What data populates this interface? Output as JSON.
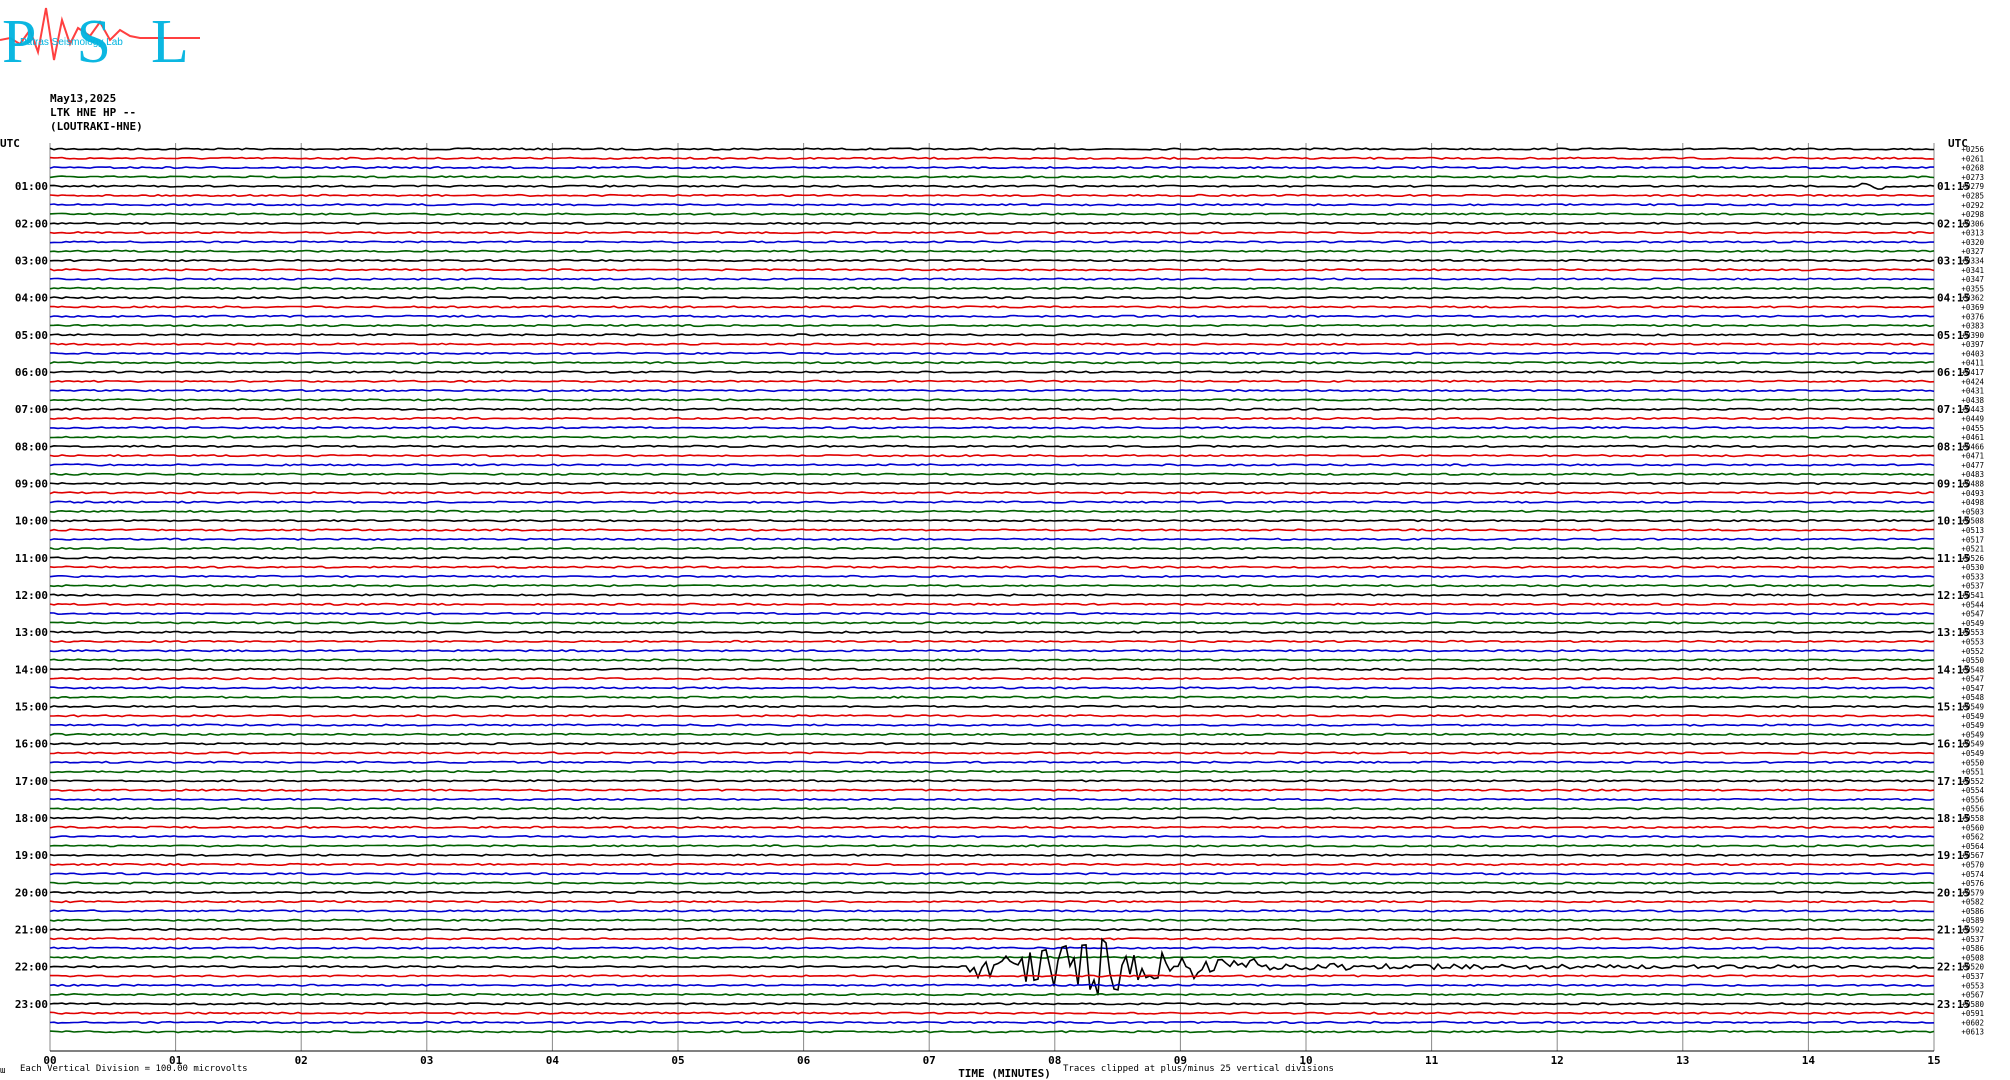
{
  "header": {
    "logo_letters": "PSL",
    "logo_subtext": "Patras Seismology Lab",
    "date": "May13,2025",
    "station_line": "LTK HNE HP --",
    "station_name": "(LOUTRAKI-HNE)"
  },
  "footer": {
    "corner_mark": "ա",
    "vertical_division": "Each Vertical Division =  100.00 microvolts",
    "clip_note": "Traces clipped at plus/minus 25 vertical divisions"
  },
  "colors": {
    "trace_cycle": [
      "#000000",
      "#e00000",
      "#0000d0",
      "#006000"
    ],
    "grid": "#888888",
    "logo_cyan": "#00b4e0",
    "logo_red": "#ff4040"
  },
  "chart_data": {
    "type": "line",
    "title": "",
    "xlabel": "TIME (MINUTES)",
    "ylabel": "UTC",
    "right_axis_label": "UTC",
    "xlim": [
      0,
      15
    ],
    "x_tick_labels": [
      "00",
      "01",
      "02",
      "03",
      "04",
      "05",
      "06",
      "07",
      "08",
      "09",
      "10",
      "11",
      "12",
      "13",
      "14",
      "15"
    ],
    "left_hour_labels": [
      "01:00",
      "02:00",
      "03:00",
      "04:00",
      "05:00",
      "06:00",
      "07:00",
      "08:00",
      "09:00",
      "10:00",
      "11:00",
      "12:00",
      "13:00",
      "14:00",
      "15:00",
      "16:00",
      "17:00",
      "18:00",
      "19:00",
      "20:00",
      "21:00",
      "22:00",
      "23:00"
    ],
    "right_hour_labels": [
      "01:15",
      "02:15",
      "03:15",
      "04:15",
      "05:15",
      "06:15",
      "07:15",
      "08:15",
      "09:15",
      "10:15",
      "11:15",
      "12:15",
      "13:15",
      "14:15",
      "15:15",
      "16:15",
      "17:15",
      "18:15",
      "19:15",
      "20:15",
      "21:15",
      "22:15",
      "23:15"
    ],
    "trace_count": 96,
    "trace_offsets": [
      "+0256",
      "+0261",
      "+0268",
      "+0273",
      "+0279",
      "+0285",
      "+0292",
      "+0298",
      "+0306",
      "+0313",
      "+0320",
      "+0327",
      "+0334",
      "+0341",
      "+0347",
      "+0355",
      "+0362",
      "+0369",
      "+0376",
      "+0383",
      "+0390",
      "+0397",
      "+0403",
      "+0411",
      "+0417",
      "+0424",
      "+0431",
      "+0438",
      "+0443",
      "+0449",
      "+0455",
      "+0461",
      "+0466",
      "+0471",
      "+0477",
      "+0483",
      "+0488",
      "+0493",
      "+0498",
      "+0503",
      "+0508",
      "+0513",
      "+0517",
      "+0521",
      "+0526",
      "+0530",
      "+0533",
      "+0537",
      "+0541",
      "+0544",
      "+0547",
      "+0549",
      "+0553",
      "+0553",
      "+0552",
      "+0550",
      "+0548",
      "+0547",
      "+0547",
      "+0548",
      "+0549",
      "+0549",
      "+0549",
      "+0549",
      "+0549",
      "+0549",
      "+0550",
      "+0551",
      "+0552",
      "+0554",
      "+0556",
      "+0556",
      "+0558",
      "+0560",
      "+0562",
      "+0564",
      "+0567",
      "+0570",
      "+0574",
      "+0576",
      "+0579",
      "+0582",
      "+0586",
      "+0589",
      "+0592",
      "+0537",
      "+0586",
      "+0508",
      "+0520",
      "+0537",
      "+0553",
      "+0567",
      "+0580",
      "+0591",
      "+0602",
      "+0613"
    ],
    "events": [
      {
        "trace": 4,
        "start_min": 14.3,
        "end_min": 14.6,
        "amplitude": "small"
      },
      {
        "trace": 88,
        "start_min": 7.3,
        "end_min": 15.0,
        "amplitude": "large",
        "peak_min": 8.25
      }
    ],
    "grid": true,
    "clip_divisions": 25,
    "vertical_division_microvolts": 100.0
  }
}
